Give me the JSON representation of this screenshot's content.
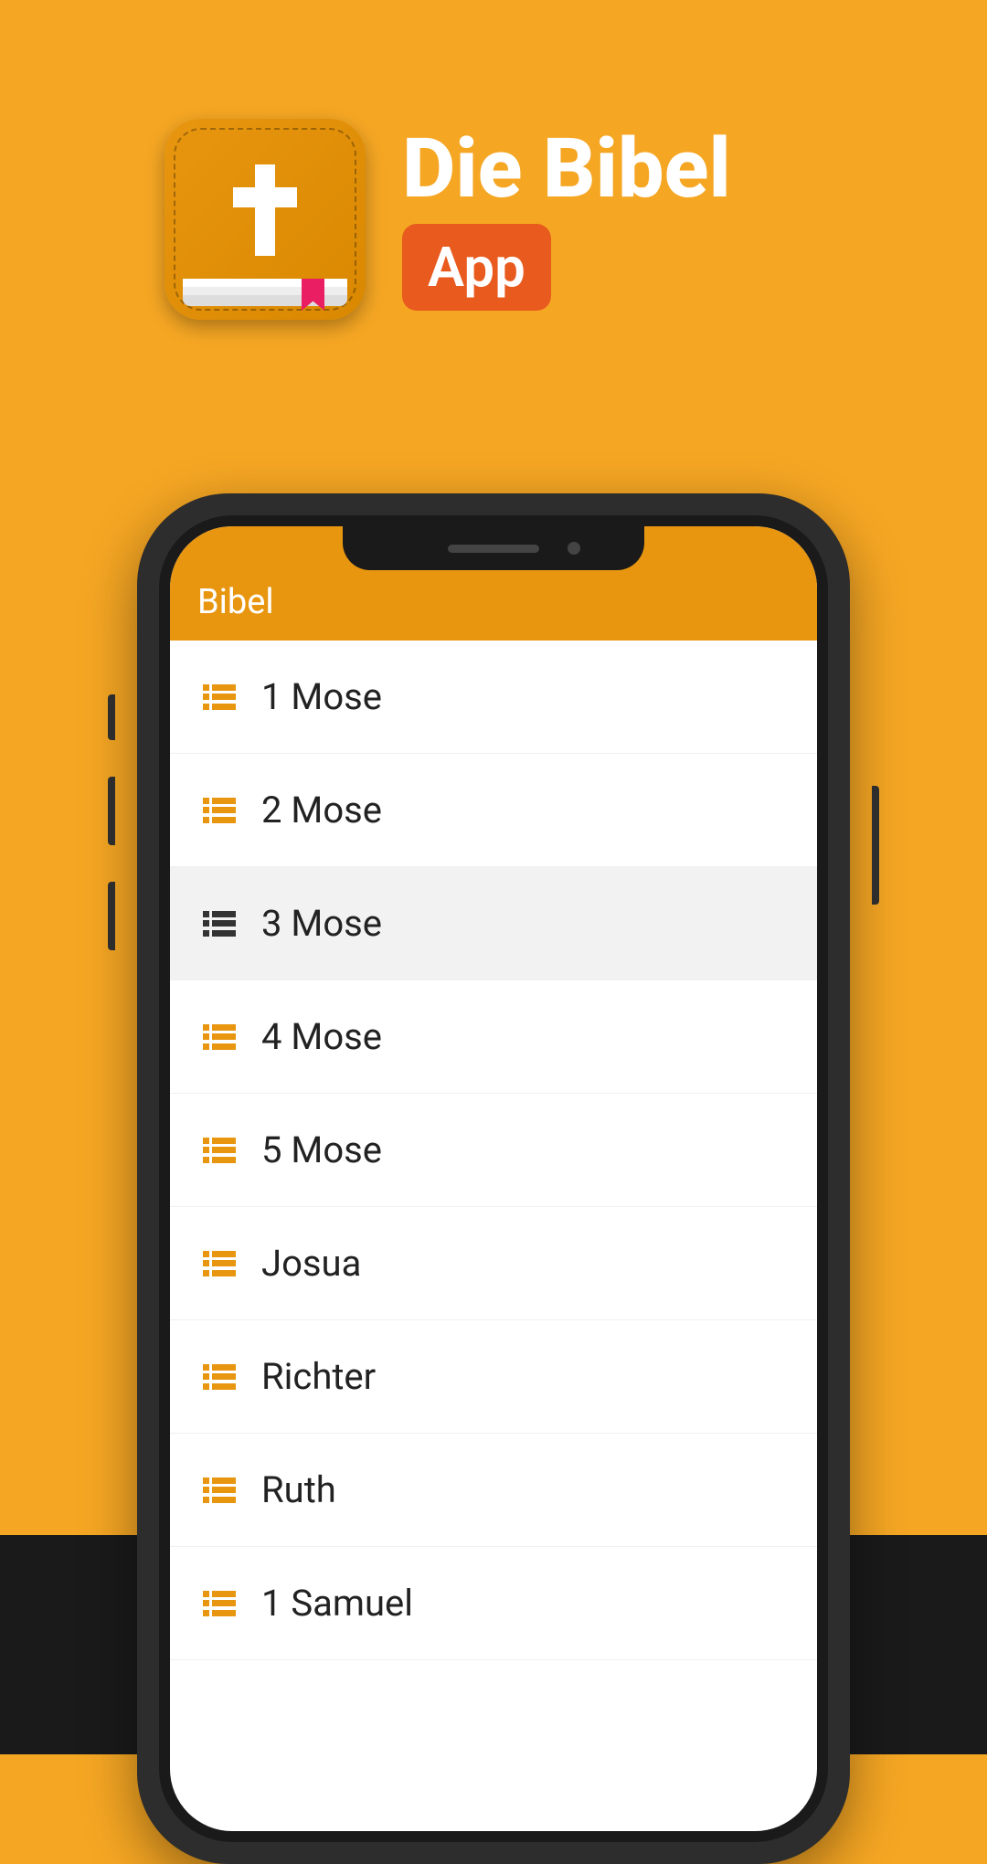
{
  "header": {
    "title": "Die Bibel",
    "badge": "App"
  },
  "app": {
    "header_title": "Bibel",
    "books": [
      {
        "name": "1 Mose",
        "selected": false
      },
      {
        "name": "2 Mose",
        "selected": false
      },
      {
        "name": "3 Mose",
        "selected": true
      },
      {
        "name": "4 Mose",
        "selected": false
      },
      {
        "name": "5 Mose",
        "selected": false
      },
      {
        "name": "Josua",
        "selected": false
      },
      {
        "name": "Richter",
        "selected": false
      },
      {
        "name": "Ruth",
        "selected": false
      },
      {
        "name": "1 Samuel",
        "selected": false
      }
    ]
  },
  "colors": {
    "background": "#F5A623",
    "accent": "#E89610",
    "badge": "#E85A1E",
    "selected_bg": "#f2f2f2",
    "selected_icon": "#333"
  }
}
